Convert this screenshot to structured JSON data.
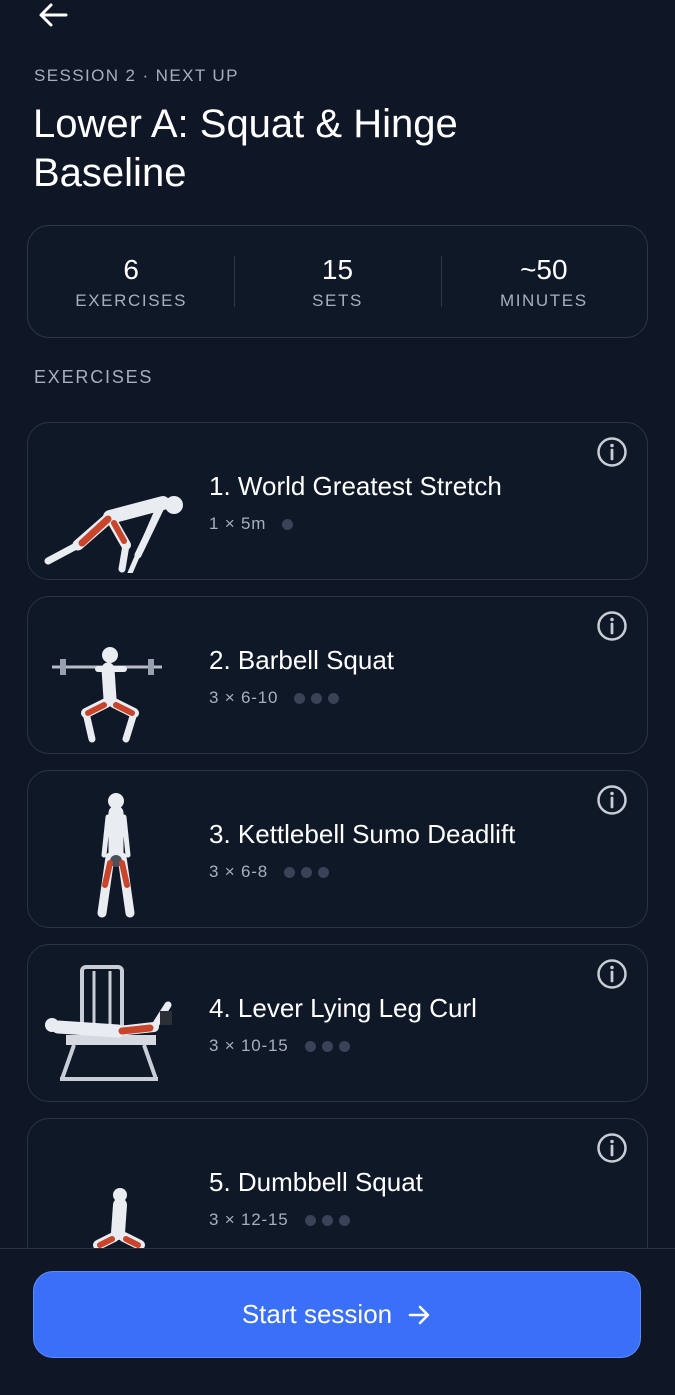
{
  "header": {
    "kicker": "SESSION 2 · NEXT UP",
    "title": "Lower A: Squat & Hinge Baseline"
  },
  "stats": [
    {
      "value": "6",
      "label": "EXERCISES"
    },
    {
      "value": "15",
      "label": "SETS"
    },
    {
      "value": "~50",
      "label": "MINUTES"
    }
  ],
  "section_label": "EXERCISES",
  "exercises": [
    {
      "name": "1. World Greatest Stretch",
      "sets": "1 × 5m",
      "set_count": 1
    },
    {
      "name": "2. Barbell Squat",
      "sets": "3 × 6-10",
      "set_count": 3
    },
    {
      "name": "3. Kettlebell Sumo Deadlift",
      "sets": "3 × 6-8",
      "set_count": 3
    },
    {
      "name": "4. Lever Lying Leg Curl",
      "sets": "3 × 10-15",
      "set_count": 3
    },
    {
      "name": "5. Dumbbell Squat",
      "sets": "3 × 12-15",
      "set_count": 3
    }
  ],
  "footer": {
    "start_label": "Start session"
  },
  "colors": {
    "background": "#0f1726",
    "card_border": "#2a3446",
    "primary": "#3a6ff7",
    "muted_text": "#a7afbf",
    "muscle_highlight": "#c8452c"
  },
  "icons": {
    "back": "arrow-left-icon",
    "info": "info-icon",
    "start": "arrow-right-icon"
  }
}
